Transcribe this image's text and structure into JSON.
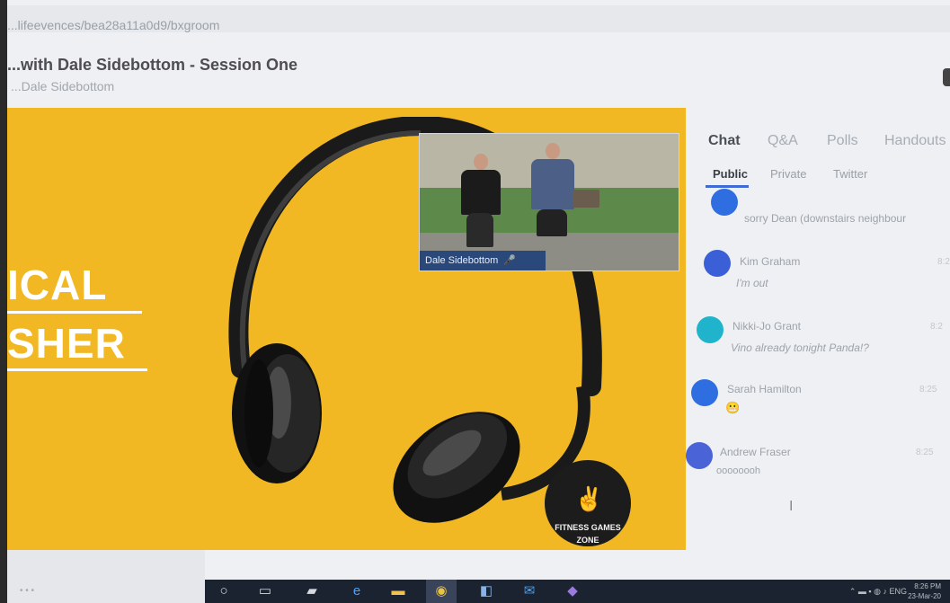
{
  "browser": {
    "url": "...lifeevences/bea28a11a0d9/bxgroom"
  },
  "session": {
    "title": "...with Dale Sidebottom - Session One",
    "host": "...Dale Sidebottom"
  },
  "stage": {
    "bg_color": "#f1b824",
    "text_line1": "ICAL",
    "text_line2": "SHER",
    "video_label": "Dale Sidebottom",
    "badge_text": "FITNESS GAMES ZONE"
  },
  "panel": {
    "tabs": [
      "Chat",
      "Q&A",
      "Polls",
      "Handouts"
    ],
    "subtabs": [
      "Public",
      "Private",
      "Twitter"
    ],
    "messages": [
      {
        "name": "",
        "text": "sorry Dean (downstairs neighbour",
        "time": "",
        "avatar_color": "#2f6ee0"
      },
      {
        "name": "Kim Graham",
        "text": "I'm out",
        "time": "8:2",
        "avatar_color": "#3a5fd6"
      },
      {
        "name": "Nikki-Jo Grant",
        "text": "Vino already tonight Panda!?",
        "time": "8:2",
        "avatar_color": "#20b3cc"
      },
      {
        "name": "Sarah Hamilton",
        "text": "",
        "time": "8:25",
        "avatar_color": "#2f6ee0",
        "emoji": "😬"
      },
      {
        "name": "Andrew Fraser",
        "text": "oooooooh",
        "time": "8:25",
        "avatar_color": "#4a64d8"
      }
    ]
  },
  "taskbar": {
    "icons": [
      "start-icon",
      "search-icon",
      "task-view-icon",
      "edge-icon",
      "explorer-icon",
      "chrome-icon",
      "store-icon",
      "mail-icon",
      "teams-icon"
    ],
    "tray": "ENG",
    "time": "8:26 PM",
    "date": "23-Mar-20"
  }
}
